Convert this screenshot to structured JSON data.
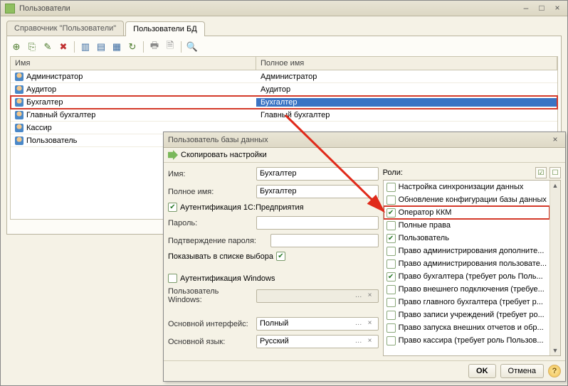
{
  "window": {
    "title": "Пользователи",
    "tabs": [
      {
        "label": "Справочник \"Пользователи\""
      },
      {
        "label": "Пользователи БД"
      }
    ],
    "columns": {
      "name": "Имя",
      "fullname": "Полное имя"
    },
    "rows": [
      {
        "name": "Администратор",
        "fullname": "Администратор"
      },
      {
        "name": "Аудитор",
        "fullname": "Аудитор"
      },
      {
        "name": "Бухгалтер",
        "fullname": "Бухгалтер",
        "selected": true
      },
      {
        "name": "Главный бухгалтер",
        "fullname": "Главный бухгалтер"
      },
      {
        "name": "Кассир",
        "fullname": ""
      },
      {
        "name": "Пользователь",
        "fullname": ""
      }
    ]
  },
  "dialog": {
    "title": "Пользователь базы данных",
    "copy_settings": "Скопировать настройки",
    "labels": {
      "name": "Имя:",
      "fullname": "Полное имя:",
      "auth1c": "Аутентификация 1С:Предприятия",
      "password": "Пароль:",
      "confirm": "Подтверждение пароля:",
      "show_in_list": "Показывать в списке выбора",
      "auth_win": "Аутентификация Windows",
      "win_user": "Пользователь Windows:",
      "main_iface": "Основной интерфейс:",
      "main_lang": "Основной язык:",
      "roles": "Роли:"
    },
    "values": {
      "name": "Бухгалтер",
      "fullname": "Бухгалтер",
      "auth1c": true,
      "show_in_list": true,
      "auth_win": false,
      "win_user": "",
      "main_iface": "Полный",
      "main_lang": "Русский"
    },
    "roles": [
      {
        "label": "Настройка синхронизации данных",
        "checked": false
      },
      {
        "label": "Обновление конфигурации базы данных",
        "checked": false
      },
      {
        "label": "Оператор ККМ",
        "checked": true,
        "highlight": true
      },
      {
        "label": "Полные права",
        "checked": false
      },
      {
        "label": "Пользователь",
        "checked": true
      },
      {
        "label": "Право администрирования дополните...",
        "checked": false
      },
      {
        "label": "Право администрирования пользовате...",
        "checked": false
      },
      {
        "label": "Право бухгалтера (требует роль Поль...",
        "checked": true
      },
      {
        "label": "Право внешнего подключения (требуе...",
        "checked": false
      },
      {
        "label": "Право главного бухгалтера (требует р...",
        "checked": false
      },
      {
        "label": "Право записи учреждений (требует ро...",
        "checked": false
      },
      {
        "label": "Право запуска внешних отчетов и обр...",
        "checked": false
      },
      {
        "label": "Право кассира (требует роль Пользов...",
        "checked": false
      }
    ],
    "buttons": {
      "ok": "OK",
      "cancel": "Отмена"
    }
  }
}
